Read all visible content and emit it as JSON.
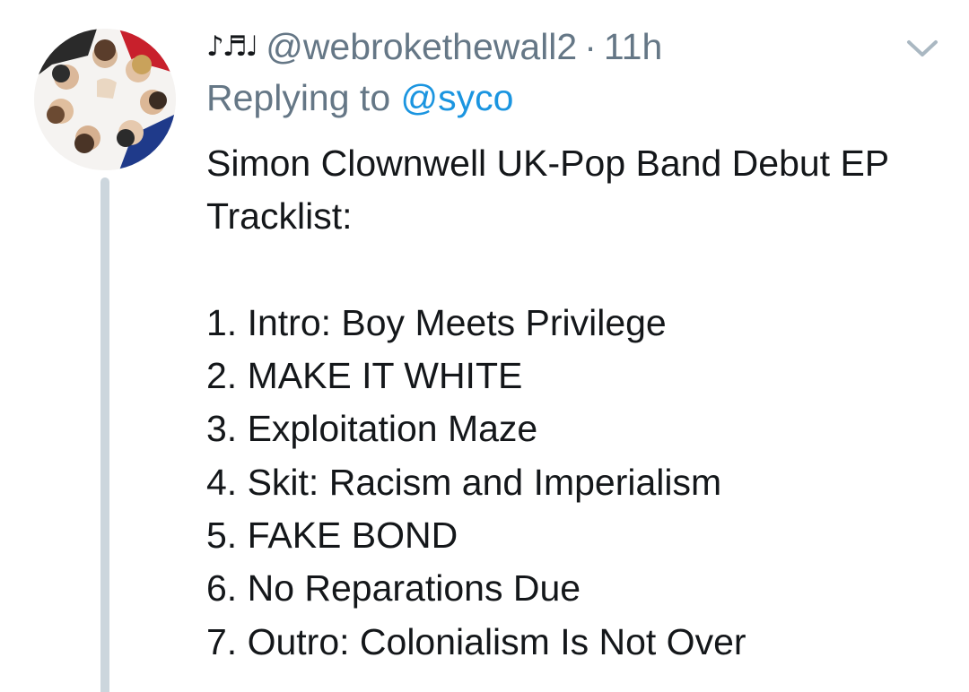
{
  "author": {
    "name_emoji": "♪♬♩",
    "handle": "@webrokethewall2",
    "separator": "·",
    "time": "11h"
  },
  "reply": {
    "prefix": "Replying to",
    "mention": "@syco"
  },
  "tweet": {
    "lines": [
      "Simon Clownwell UK-Pop Band Debut EP",
      "Tracklist:"
    ],
    "tracks": [
      "1. Intro: Boy Meets Privilege",
      "2. MAKE IT WHITE",
      "3. Exploitation Maze",
      "4. Skit: Racism and Imperialism",
      "5. FAKE BOND",
      "6. No Reparations Due",
      "7. Outro: Colonialism Is Not Over"
    ]
  },
  "icons": {
    "menu": "chevron-down-icon",
    "avatar": "avatar"
  },
  "colors": {
    "text": "#14171a",
    "secondary": "#657786",
    "link": "#1b95e0",
    "thread": "#ccd6dd"
  }
}
